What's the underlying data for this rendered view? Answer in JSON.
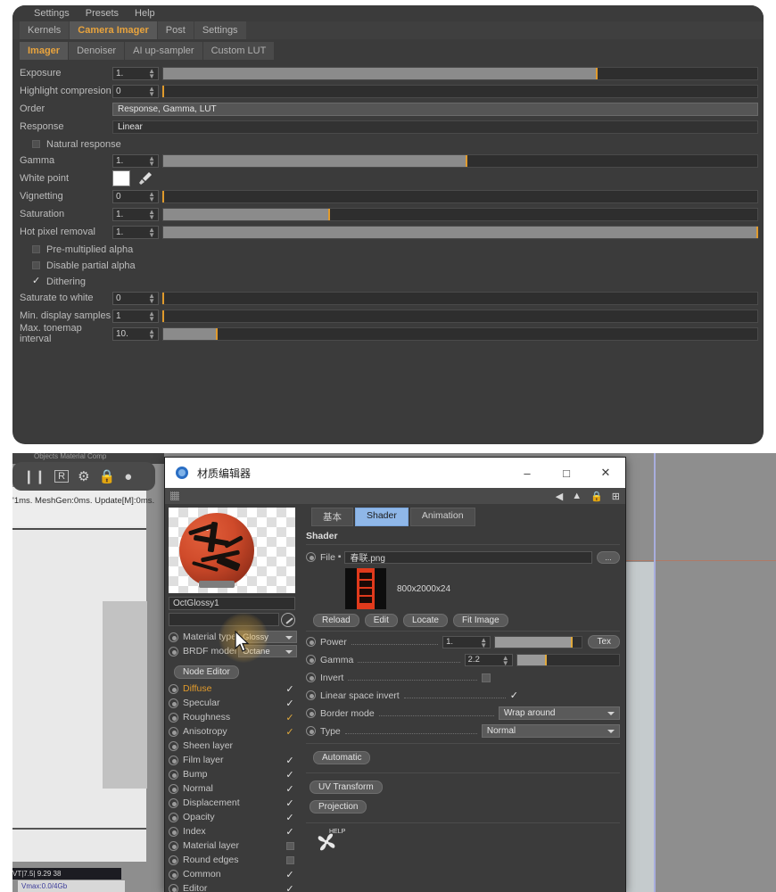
{
  "octane": {
    "menu": [
      "Settings",
      "Presets",
      "Help"
    ],
    "tabs": [
      {
        "label": "Kernels",
        "selected": false
      },
      {
        "label": "Camera Imager",
        "selected": true
      },
      {
        "label": "Post",
        "selected": false
      },
      {
        "label": "Settings",
        "selected": false
      }
    ],
    "subtabs": [
      {
        "label": "Imager",
        "selected": true
      },
      {
        "label": "Denoiser",
        "selected": false
      },
      {
        "label": "AI up-sampler",
        "selected": false
      },
      {
        "label": "Custom LUT",
        "selected": false
      }
    ],
    "rows": [
      {
        "type": "slider",
        "label": "Exposure",
        "value": "1.",
        "fill": 73,
        "knob": 73
      },
      {
        "type": "slider",
        "label": "Highlight compresion",
        "value": "0",
        "fill": 0,
        "knob": 0
      },
      {
        "type": "field",
        "label": "Order",
        "value": "Response, Gamma, LUT",
        "light": true
      },
      {
        "type": "field",
        "label": "Response",
        "value": "Linear",
        "light": false
      },
      {
        "type": "check",
        "label": "Natural response",
        "checked": false
      },
      {
        "type": "slider",
        "label": "Gamma",
        "value": "1.",
        "fill": 51,
        "knob": 51
      },
      {
        "type": "color",
        "label": "White point",
        "swatch": "#ffffff"
      },
      {
        "type": "slider",
        "label": "Vignetting",
        "value": "0",
        "fill": 0,
        "knob": 0
      },
      {
        "type": "slider",
        "label": "Saturation",
        "value": "1.",
        "fill": 28,
        "knob": 28
      },
      {
        "type": "slider",
        "label": "Hot pixel removal",
        "value": "1.",
        "fill": 100,
        "knob": 100
      },
      {
        "type": "check",
        "label": "Pre-multiplied alpha",
        "checked": false
      },
      {
        "type": "check",
        "label": "Disable partial alpha",
        "checked": false
      },
      {
        "type": "check",
        "label": "Dithering",
        "checked": true
      },
      {
        "type": "slider",
        "label": "Saturate to white",
        "value": "0",
        "fill": 0,
        "knob": 0
      },
      {
        "type": "slider",
        "label": "Min. display samples",
        "value": "1",
        "fill": 0,
        "knob": 0
      },
      {
        "type": "slider",
        "label": "Max. tonemap interval",
        "value": "10.",
        "fill": 9,
        "knob": 9
      }
    ]
  },
  "c4d": {
    "stats": "'1ms. MeshGen:0ms. Update[M]:0ms.",
    "topstrip": "Objects   Material   Comp",
    "toolbar_icons": [
      "pause-icon",
      "render-region-icon",
      "settings-gear-icon",
      "lock-icon",
      "sphere-icon"
    ],
    "statusbar_left": "VT|7.5|      9.29      38",
    "statusbar_bottom": "Vmax:0.0/4Gb"
  },
  "matwin": {
    "title": "材质编辑器",
    "window_buttons": [
      "–",
      "□",
      "✕"
    ],
    "sub_icons": [
      "back-arrow-icon",
      "up-arrow-icon",
      "lock-icon",
      "expand-icon"
    ],
    "material_name": "OctGlossy1",
    "search_value": "",
    "material_type": {
      "label": "Material type",
      "value": "Glossy"
    },
    "brdf_model": {
      "label": "BRDF model",
      "value": "Octane"
    },
    "node_editor_label": "Node Editor",
    "channels": [
      {
        "label": "Diffuse",
        "state": "check",
        "accent": true
      },
      {
        "label": "Specular",
        "state": "check",
        "accent": false
      },
      {
        "label": "Roughness",
        "state": "check-amber",
        "accent": false
      },
      {
        "label": "Anisotropy",
        "state": "check-amber",
        "accent": false
      },
      {
        "label": "Sheen layer",
        "state": "none",
        "accent": false
      },
      {
        "label": "Film layer",
        "state": "check",
        "accent": false
      },
      {
        "label": "Bump",
        "state": "check",
        "accent": false
      },
      {
        "label": "Normal",
        "state": "check",
        "accent": false
      },
      {
        "label": "Displacement",
        "state": "check",
        "accent": false
      },
      {
        "label": "Opacity",
        "state": "check",
        "accent": false
      },
      {
        "label": "Index",
        "state": "check",
        "accent": false
      },
      {
        "label": "Material layer",
        "state": "box",
        "accent": false
      },
      {
        "label": "Round edges",
        "state": "box",
        "accent": false
      },
      {
        "label": "Common",
        "state": "check",
        "accent": false
      },
      {
        "label": "Editor",
        "state": "check",
        "accent": false
      }
    ],
    "tabs": [
      {
        "label": "基本",
        "selected": false
      },
      {
        "label": "Shader",
        "selected": true
      },
      {
        "label": "Animation",
        "selected": false
      }
    ],
    "section_title": "Shader",
    "file": {
      "label": "File",
      "value": "春联.png",
      "browse": "..."
    },
    "texture_size": "800x2000x24",
    "action_buttons": [
      "Reload",
      "Edit",
      "Locate",
      "Fit Image"
    ],
    "params": [
      {
        "type": "slider",
        "label": "Power",
        "value": "1.",
        "fill": 88,
        "knob": 88,
        "extra": "Tex"
      },
      {
        "type": "slider",
        "label": "Gamma",
        "value": "2.2",
        "fill": 28,
        "knob": 28,
        "extra": ""
      },
      {
        "type": "box",
        "label": "Invert",
        "checked": false
      },
      {
        "type": "check",
        "label": "Linear space invert",
        "checked": true
      },
      {
        "type": "dropdown",
        "label": "Border mode",
        "value": "Wrap around"
      },
      {
        "type": "dropdown",
        "label": "Type",
        "value": "Normal"
      }
    ],
    "automatic_label": "Automatic",
    "uv_transform_label": "UV Transform",
    "projection_label": "Projection",
    "help_label": "HELP"
  }
}
